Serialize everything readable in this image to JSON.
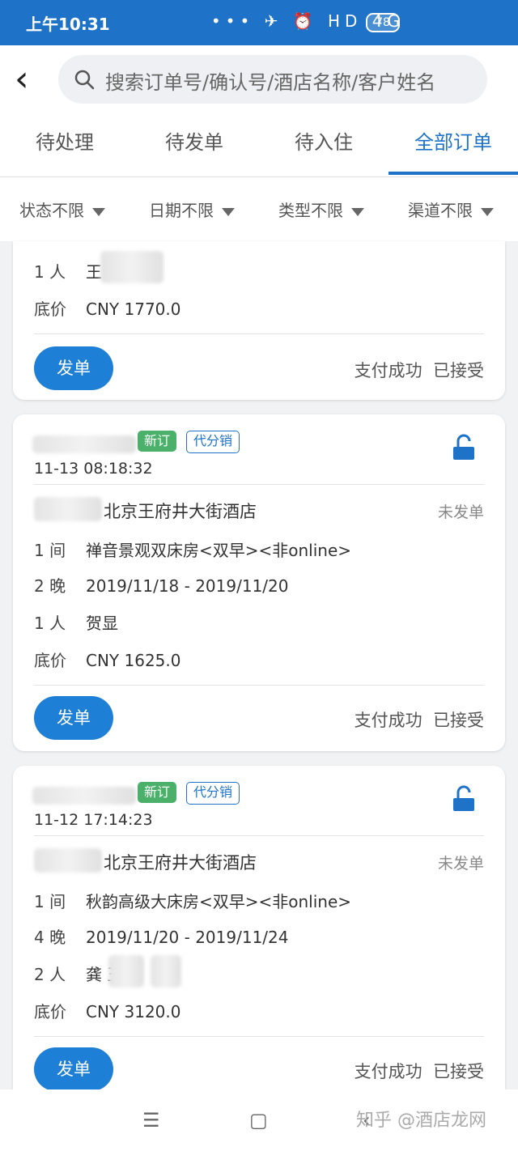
{
  "status_bar": {
    "time": "上午10:31",
    "icons_text": "••• ✈ ⏰ HD 4G",
    "battery": "78"
  },
  "header": {
    "search_placeholder": "搜索订单号/确认号/酒店名称/客户姓名",
    "tabs": [
      {
        "label": "待处理"
      },
      {
        "label": "待发单"
      },
      {
        "label": "待入住"
      },
      {
        "label": "全部订单",
        "active": true
      }
    ],
    "filters": [
      {
        "label": "状态不限"
      },
      {
        "label": "日期不限"
      },
      {
        "label": "类型不限"
      },
      {
        "label": "渠道不限"
      }
    ]
  },
  "orders": [
    {
      "guests": "1 人",
      "guest_names": "王",
      "price_key": "底价",
      "price": "CNY 1770.0",
      "send_label": "发单",
      "pay_status": "支付成功",
      "accept_status": "已接受"
    },
    {
      "tag_new": "新订",
      "tag_channel": "代分销",
      "time": "11-13 08:18:32",
      "hotel": "北京王府井大街酒店",
      "dispatch_status": "未发单",
      "rooms_key": "1 间",
      "room_type": "禅音景观双床房<双早><非online>",
      "nights_key": "2 晚",
      "dates": "2019/11/18 - 2019/11/20",
      "guests": "1 人",
      "guest_names": "贺显",
      "price_key": "底价",
      "price": "CNY 1625.0",
      "send_label": "发单",
      "pay_status": "支付成功",
      "accept_status": "已接受"
    },
    {
      "tag_new": "新订",
      "tag_channel": "代分销",
      "time": "11-12 17:14:23",
      "hotel": "北京王府井大街酒店",
      "dispatch_status": "未发单",
      "rooms_key": "1 间",
      "room_type": "秋韵高级大床房<双早><非online>",
      "nights_key": "4 晚",
      "dates": "2019/11/20 - 2019/11/24",
      "guests": "2 人",
      "guest_names": "龚 王",
      "price_key": "底价",
      "price": "CNY 3120.0",
      "send_label": "发单",
      "pay_status": "支付成功",
      "accept_status": "已接受"
    }
  ],
  "nav": {
    "menu": "☰",
    "home": "▢",
    "back": "‹",
    "watermark": "知乎 @酒店龙网"
  },
  "colors": {
    "primary": "#1e73c8",
    "button": "#1e7fd6",
    "tag_green": "#4bb16a"
  }
}
